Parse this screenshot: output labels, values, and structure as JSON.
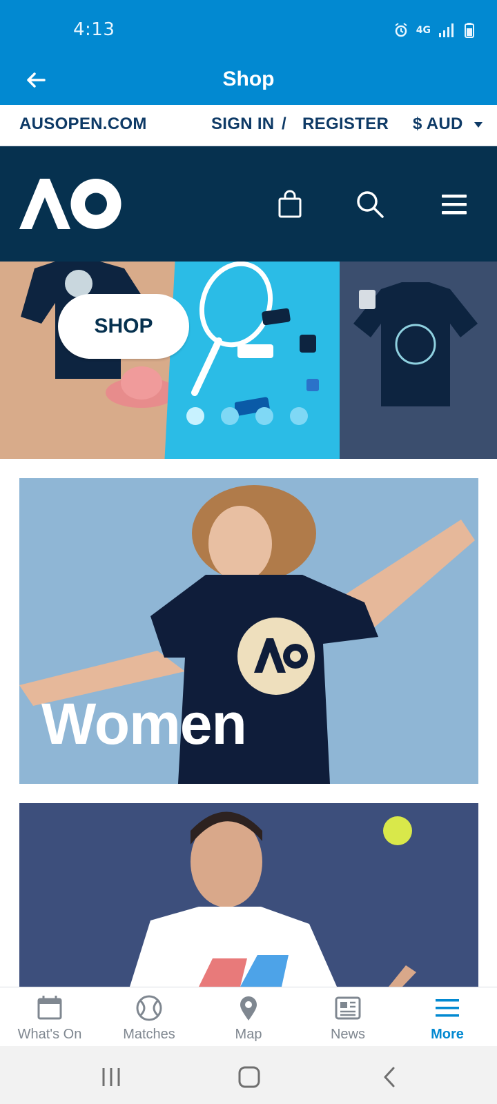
{
  "status_bar": {
    "time": "4:13",
    "network": "4G"
  },
  "header": {
    "title": "Shop"
  },
  "links_bar": {
    "home_link": "AUSOPEN.COM",
    "sign_in": "SIGN IN",
    "separator": "/",
    "register": "REGISTER",
    "currency": "$ AUD"
  },
  "hero": {
    "button_label": "SHOP",
    "slide_count": 4,
    "active_slide": 1
  },
  "cards": {
    "women": {
      "title": "Women"
    },
    "men": {
      "title": ""
    }
  },
  "bottom_nav": {
    "items": [
      {
        "label": "What's On",
        "icon": "calendar-icon"
      },
      {
        "label": "Matches",
        "icon": "tennis-ball-icon"
      },
      {
        "label": "Map",
        "icon": "map-pin-icon"
      },
      {
        "label": "News",
        "icon": "news-icon"
      },
      {
        "label": "More",
        "icon": "hamburger-icon",
        "active": true
      }
    ]
  },
  "colors": {
    "primary": "#0289d1",
    "navy": "#06314f",
    "text_dark": "#0e3a66",
    "inactive": "#7f8790"
  }
}
